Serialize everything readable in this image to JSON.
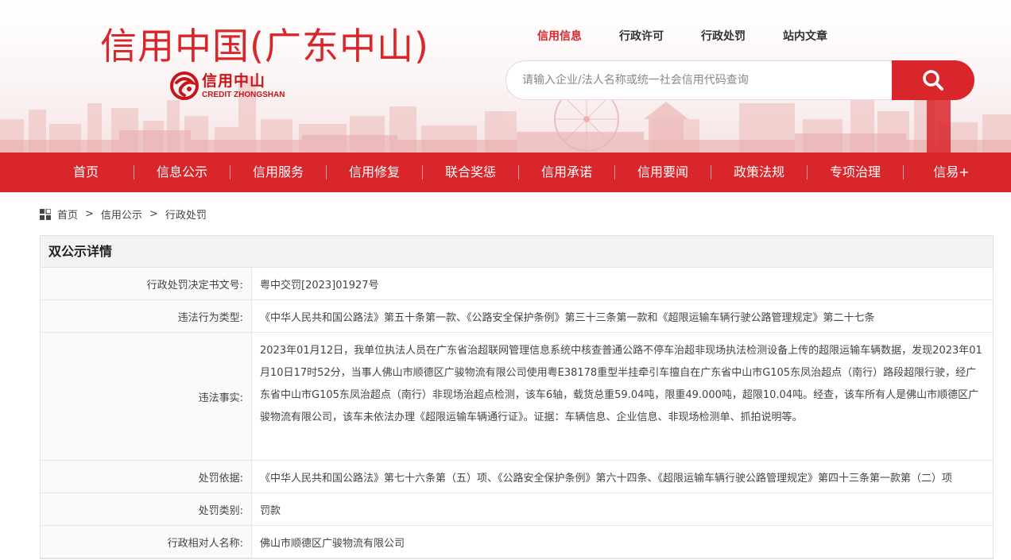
{
  "header": {
    "site_title": "信用中国(广东中山)",
    "logo_cn": "信用中山",
    "logo_en": "CREDIT ZHONGSHAN",
    "top_nav": [
      {
        "label": "信用信息",
        "active": true
      },
      {
        "label": "行政许可",
        "active": false
      },
      {
        "label": "行政处罚",
        "active": false
      },
      {
        "label": "站内文章",
        "active": false
      }
    ],
    "search": {
      "placeholder": "请输入企业/法人名称或统一社会信用代码查询",
      "value": ""
    }
  },
  "main_nav": {
    "items": [
      "首页",
      "信息公示",
      "信用服务",
      "信用修复",
      "联合奖惩",
      "信用承诺",
      "信用要闻",
      "政策法规",
      "专项治理",
      "信易+"
    ]
  },
  "breadcrumb": {
    "items": [
      "首页",
      "信用公示",
      "行政处罚"
    ],
    "separator": ">"
  },
  "detail": {
    "title": "双公示详情",
    "rows": [
      {
        "label": "行政处罚决定书文号:",
        "value": "粤中交罚[2023]01927号"
      },
      {
        "label": "违法行为类型:",
        "value": "《中华人民共和国公路法》第五十条第一款、《公路安全保护条例》第三十三条第一款和《超限运输车辆行驶公路管理规定》第二十七条"
      },
      {
        "label": "违法事实:",
        "value": "2023年01月12日，我单位执法人员在广东省治超联网管理信息系统中核查普通公路不停车治超非现场执法检测设备上传的超限运输车辆数据，发现2023年01月10日17时52分，当事人佛山市顺德区广骏物流有限公司使用粤E38178重型半挂牵引车擅自在广东省中山市G105东凤治超点（南行）路段超限行驶，经广东省中山市G105东凤治超点（南行）非现场治超点检测，该车6轴，载货总重59.04吨，限重49.000吨，超限10.04吨。经查，该车所有人是佛山市顺德区广骏物流有限公司，该车未依法办理《超限运输车辆通行证》。证据：车辆信息、企业信息、非现场检测单、抓拍说明等。"
      },
      {
        "label": "处罚依据:",
        "value": "《中华人民共和国公路法》第七十六条第（五）项、《公路安全保护条例》第六十四条、《超限运输车辆行驶公路管理规定》第四十三条第一款第（二）项"
      },
      {
        "label": "处罚类别:",
        "value": "罚款"
      },
      {
        "label": "行政相对人名称:",
        "value": "佛山市顺德区广骏物流有限公司"
      }
    ]
  },
  "colors": {
    "brand_red": "#d8262b",
    "panel_head_bg": "#f3f3f3",
    "border": "#e2e2e2"
  },
  "icons": {
    "search": "magnifier-icon",
    "breadcrumb": "grid-icon",
    "logo": "credit-zhongshan-logo-icon"
  }
}
